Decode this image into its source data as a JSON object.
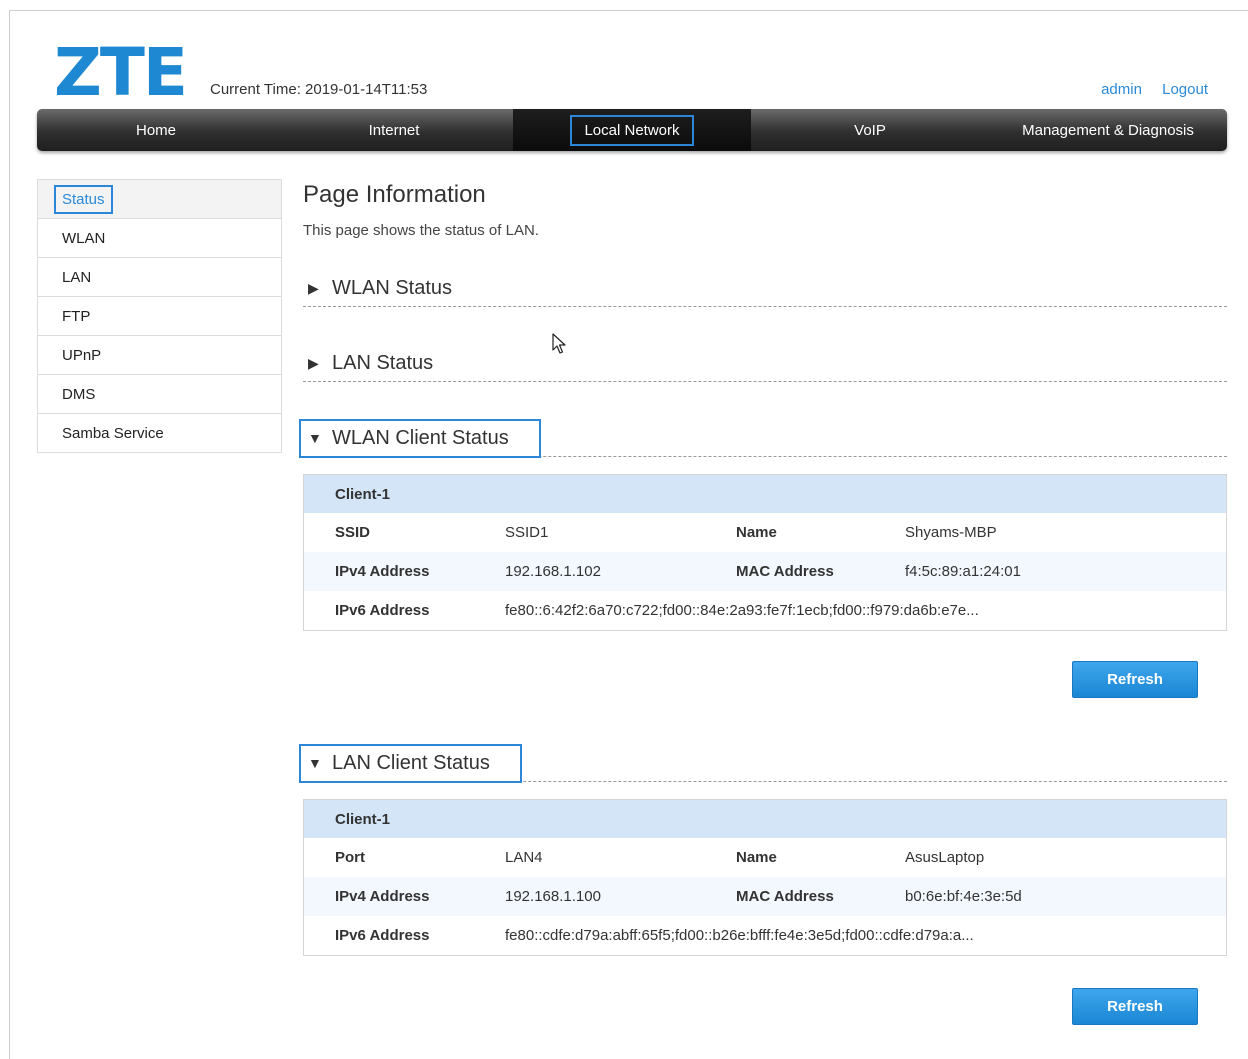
{
  "brand": {
    "logo": "ZTE",
    "accent": "#1e88d2"
  },
  "header": {
    "current_time": "Current Time: 2019-01-14T11:53",
    "user": "admin",
    "logout": "Logout"
  },
  "nav": {
    "items": [
      "Home",
      "Internet",
      "Local Network",
      "VoIP",
      "Management & Diagnosis"
    ],
    "active": "Local Network"
  },
  "sidebar": {
    "items": [
      "Status",
      "WLAN",
      "LAN",
      "FTP",
      "UPnP",
      "DMS",
      "Samba Service"
    ],
    "active": "Status"
  },
  "page": {
    "title": "Page Information",
    "description": "This page shows the status of LAN."
  },
  "sections": {
    "wlan_status": {
      "title": "WLAN Status",
      "expanded": false
    },
    "lan_status": {
      "title": "LAN Status",
      "expanded": false
    },
    "wlan_client_status": {
      "title": "WLAN Client Status",
      "expanded": true
    },
    "lan_client_status": {
      "title": "LAN Client Status",
      "expanded": true
    }
  },
  "wlan_client": {
    "header": "Client-1",
    "ssid_label": "SSID",
    "ssid": "SSID1",
    "name_label": "Name",
    "name": "Shyams-MBP",
    "ipv4_label": "IPv4 Address",
    "ipv4": "192.168.1.102",
    "mac_label": "MAC Address",
    "mac": "f4:5c:89:a1:24:01",
    "ipv6_label": "IPv6 Address",
    "ipv6": "fe80::6:42f2:6a70:c722;fd00::84e:2a93:fe7f:1ecb;fd00::f979:da6b:e7e..."
  },
  "lan_client": {
    "header": "Client-1",
    "port_label": "Port",
    "port": "LAN4",
    "name_label": "Name",
    "name": "AsusLaptop",
    "ipv4_label": "IPv4 Address",
    "ipv4": "192.168.1.100",
    "mac_label": "MAC Address",
    "mac": "b0:6e:bf:4e:3e:5d",
    "ipv6_label": "IPv6 Address",
    "ipv6": "fe80::cdfe:d79a:abff:65f5;fd00::b26e:bfff:fe4e:3e5d;fd00::cdfe:d79a:a..."
  },
  "buttons": {
    "refresh": "Refresh"
  },
  "icons": {
    "collapsed": "▶",
    "expanded": "▼",
    "cursor": "mouse-pointer-icon"
  }
}
